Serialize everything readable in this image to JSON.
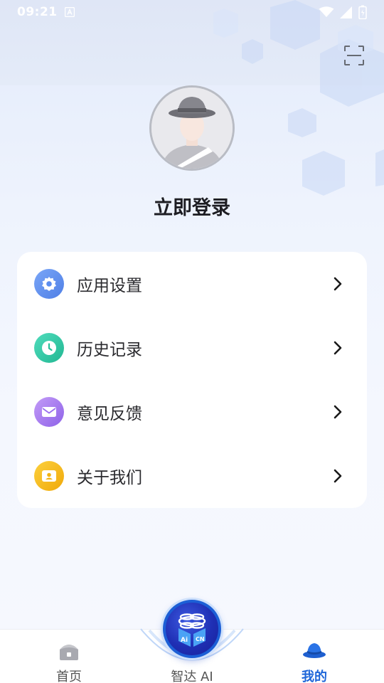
{
  "status_bar": {
    "time": "09:21"
  },
  "profile": {
    "login_label": "立即登录"
  },
  "menu": {
    "items": [
      {
        "label": "应用设置",
        "icon": "gear-icon",
        "color": "#5b8def"
      },
      {
        "label": "历史记录",
        "icon": "clock-icon",
        "color": "#2fc9a5"
      },
      {
        "label": "意见反馈",
        "icon": "mail-icon",
        "color": "#a97bf0"
      },
      {
        "label": "关于我们",
        "icon": "contact-card-icon",
        "color": "#f5b516"
      }
    ]
  },
  "tabbar": {
    "tabs": [
      {
        "label": "首页",
        "icon": "home-icon",
        "active": false
      },
      {
        "label": "智达 AI",
        "icon": "ai-logo-icon",
        "active": false
      },
      {
        "label": "我的",
        "icon": "hat-icon",
        "active": true
      }
    ],
    "active_color": "#1e66d9",
    "inactive_color": "#555555"
  }
}
